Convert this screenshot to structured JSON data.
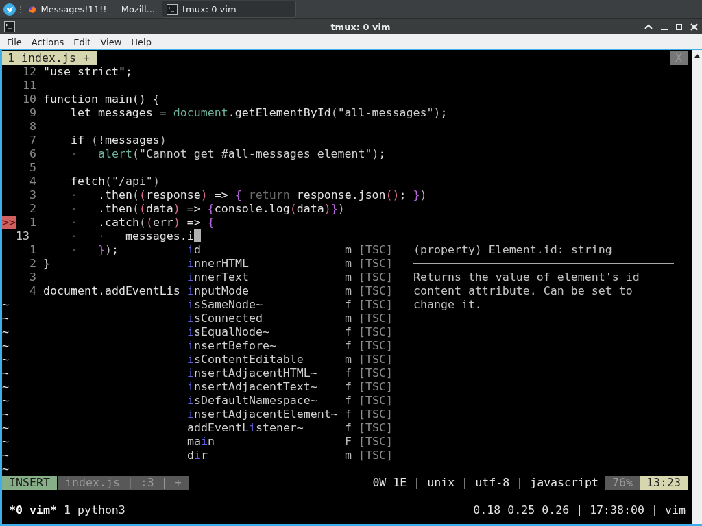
{
  "taskbar": {
    "tasks": [
      {
        "kind": "browser",
        "label": "Messages!11!! — Mozill...",
        "selected": false
      },
      {
        "kind": "terminal",
        "label": "tmux: 0 vim",
        "selected": true
      }
    ]
  },
  "window": {
    "title": "tmux: 0 vim"
  },
  "menu": [
    "File",
    "Actions",
    "Edit",
    "View",
    "Help"
  ],
  "editor": {
    "tabline": {
      "buffer": "1 index.js +",
      "close": "X"
    },
    "rows": [
      {
        "kind": "code",
        "num": "12",
        "current": false,
        "segments": [
          {
            "kind": "text",
            "text": "\"use strict\";"
          }
        ]
      },
      {
        "kind": "code",
        "num": "11",
        "current": false
      },
      {
        "kind": "code",
        "num": "10",
        "current": false,
        "segments": [
          {
            "kind": "text",
            "text": "function main() {"
          }
        ]
      },
      {
        "kind": "code",
        "num": "9",
        "current": false,
        "segments": [
          {
            "kind": "text",
            "text": "    let messages = "
          },
          {
            "kind": "builtin",
            "text": "document"
          },
          {
            "kind": "text",
            "text": ".getElementById"
          },
          {
            "kind": "paren1",
            "text": "("
          },
          {
            "kind": "string",
            "text": "\"all-messages\""
          },
          {
            "kind": "paren1",
            "text": ")"
          },
          {
            "kind": "text",
            "text": ";"
          }
        ]
      },
      {
        "kind": "code",
        "num": "8",
        "current": false
      },
      {
        "kind": "code",
        "num": "7",
        "current": false,
        "segments": [
          {
            "kind": "text",
            "text": "    if "
          },
          {
            "kind": "paren1",
            "text": "("
          },
          {
            "kind": "text",
            "text": "!messages"
          },
          {
            "kind": "paren1",
            "text": ")"
          }
        ]
      },
      {
        "kind": "code",
        "num": "6",
        "current": false,
        "segments": [
          {
            "kind": "guide",
            "text": "    ·   "
          },
          {
            "kind": "builtin",
            "text": "alert"
          },
          {
            "kind": "paren1",
            "text": "("
          },
          {
            "kind": "string",
            "text": "\"Cannot get #all-messages element\""
          },
          {
            "kind": "paren1",
            "text": ")"
          },
          {
            "kind": "text",
            "text": ";"
          }
        ]
      },
      {
        "kind": "code",
        "num": "5",
        "current": false
      },
      {
        "kind": "code",
        "num": "4",
        "current": false,
        "segments": [
          {
            "kind": "text",
            "text": "    fetch"
          },
          {
            "kind": "paren1",
            "text": "("
          },
          {
            "kind": "string",
            "text": "\"/api\""
          },
          {
            "kind": "paren1",
            "text": ")"
          }
        ]
      },
      {
        "kind": "code",
        "num": "3",
        "current": false,
        "segments": [
          {
            "kind": "guide",
            "text": "    ·   "
          },
          {
            "kind": "text",
            "text": ".then"
          },
          {
            "kind": "paren1",
            "text": "("
          },
          {
            "kind": "paren2",
            "text": "("
          },
          {
            "kind": "text",
            "text": "response"
          },
          {
            "kind": "paren2",
            "text": ")"
          },
          {
            "kind": "text",
            "text": " => "
          },
          {
            "kind": "paren3",
            "text": "{"
          },
          {
            "kind": "dim",
            "text": " return"
          },
          {
            "kind": "text",
            "text": " response.json"
          },
          {
            "kind": "paren2",
            "text": "()"
          },
          {
            "kind": "text",
            "text": "; "
          },
          {
            "kind": "paren3",
            "text": "}"
          },
          {
            "kind": "paren1",
            "text": ")"
          }
        ]
      },
      {
        "kind": "code",
        "num": "2",
        "current": false,
        "segments": [
          {
            "kind": "guide",
            "text": "    ·   "
          },
          {
            "kind": "text",
            "text": ".then"
          },
          {
            "kind": "paren1",
            "text": "("
          },
          {
            "kind": "paren2",
            "text": "("
          },
          {
            "kind": "text",
            "text": "data"
          },
          {
            "kind": "paren2",
            "text": ")"
          },
          {
            "kind": "text",
            "text": " => "
          },
          {
            "kind": "paren3",
            "text": "{"
          },
          {
            "kind": "text",
            "text": "console.log"
          },
          {
            "kind": "paren2",
            "text": "("
          },
          {
            "kind": "text",
            "text": "data"
          },
          {
            "kind": "paren2",
            "text": ")"
          },
          {
            "kind": "paren3",
            "text": "}"
          },
          {
            "kind": "paren1",
            "text": ")"
          }
        ]
      },
      {
        "kind": "code",
        "num": "1",
        "current": false,
        "sign": {
          "kind": "error",
          "text": ">>"
        },
        "segments": [
          {
            "kind": "guide",
            "text": "    ·   "
          },
          {
            "kind": "text",
            "text": ".catch"
          },
          {
            "kind": "paren1",
            "text": "("
          },
          {
            "kind": "paren2",
            "text": "("
          },
          {
            "kind": "text",
            "text": "err"
          },
          {
            "kind": "paren2",
            "text": ")"
          },
          {
            "kind": "text",
            "text": " => "
          },
          {
            "kind": "paren3",
            "text": "{"
          }
        ]
      },
      {
        "kind": "code",
        "num": "13",
        "current": true,
        "segments": [
          {
            "kind": "guide",
            "text": "    ·   ·   "
          },
          {
            "kind": "text",
            "text": "messages.i"
          }
        ]
      },
      {
        "kind": "code",
        "num": "1",
        "current": false,
        "segments": [
          {
            "kind": "guide",
            "text": "    ·   "
          },
          {
            "kind": "paren3",
            "text": "}"
          },
          {
            "kind": "paren1",
            "text": ")"
          },
          {
            "kind": "text",
            "text": ";"
          }
        ]
      },
      {
        "kind": "code",
        "num": "2",
        "current": false,
        "segments": [
          {
            "kind": "text",
            "text": "}"
          }
        ]
      },
      {
        "kind": "code",
        "num": "3",
        "current": false
      },
      {
        "kind": "code",
        "num": "4",
        "current": false,
        "segments": [
          {
            "kind": "text",
            "text": "document.addEventLis"
          }
        ]
      },
      {
        "kind": "filler",
        "text": "~"
      },
      {
        "kind": "filler",
        "text": "~"
      },
      {
        "kind": "filler",
        "text": "~"
      },
      {
        "kind": "filler",
        "text": "~"
      },
      {
        "kind": "filler",
        "text": "~"
      },
      {
        "kind": "filler",
        "text": "~"
      },
      {
        "kind": "filler",
        "text": "~"
      },
      {
        "kind": "filler",
        "text": "~"
      },
      {
        "kind": "filler",
        "text": "~"
      },
      {
        "kind": "filler",
        "text": "~"
      },
      {
        "kind": "filler",
        "text": "~"
      },
      {
        "kind": "filler",
        "text": "~"
      },
      {
        "kind": "filler",
        "text": "~"
      }
    ],
    "completion": {
      "items": [
        {
          "parts": [
            {
              "text": "i",
              "match": true
            },
            {
              "text": "d",
              "match": false
            }
          ],
          "type": "m",
          "source": "[TSC]"
        },
        {
          "parts": [
            {
              "text": "i",
              "match": true
            },
            {
              "text": "nnerHTML",
              "match": false
            }
          ],
          "type": "m",
          "source": "[TSC]"
        },
        {
          "parts": [
            {
              "text": "i",
              "match": true
            },
            {
              "text": "nnerText",
              "match": false
            }
          ],
          "type": "m",
          "source": "[TSC]"
        },
        {
          "parts": [
            {
              "text": "i",
              "match": true
            },
            {
              "text": "nputMode",
              "match": false
            }
          ],
          "type": "m",
          "source": "[TSC]"
        },
        {
          "parts": [
            {
              "text": "i",
              "match": true
            },
            {
              "text": "sSameNode~",
              "match": false
            }
          ],
          "type": "f",
          "source": "[TSC]"
        },
        {
          "parts": [
            {
              "text": "i",
              "match": true
            },
            {
              "text": "sConnected",
              "match": false
            }
          ],
          "type": "m",
          "source": "[TSC]"
        },
        {
          "parts": [
            {
              "text": "i",
              "match": true
            },
            {
              "text": "sEqualNode~",
              "match": false
            }
          ],
          "type": "f",
          "source": "[TSC]"
        },
        {
          "parts": [
            {
              "text": "i",
              "match": true
            },
            {
              "text": "nsertBefore~",
              "match": false
            }
          ],
          "type": "f",
          "source": "[TSC]"
        },
        {
          "parts": [
            {
              "text": "i",
              "match": true
            },
            {
              "text": "sContentEditable",
              "match": false
            }
          ],
          "type": "m",
          "source": "[TSC]"
        },
        {
          "parts": [
            {
              "text": "i",
              "match": true
            },
            {
              "text": "nsertAdjacentHTML~",
              "match": false
            }
          ],
          "type": "f",
          "source": "[TSC]"
        },
        {
          "parts": [
            {
              "text": "i",
              "match": true
            },
            {
              "text": "nsertAdjacentText~",
              "match": false
            }
          ],
          "type": "f",
          "source": "[TSC]"
        },
        {
          "parts": [
            {
              "text": "i",
              "match": true
            },
            {
              "text": "sDefaultNamespace~",
              "match": false
            }
          ],
          "type": "f",
          "source": "[TSC]"
        },
        {
          "parts": [
            {
              "text": "i",
              "match": true
            },
            {
              "text": "nsertAdjacentElement~",
              "match": false
            }
          ],
          "type": "f",
          "source": "[TSC]"
        },
        {
          "parts": [
            {
              "text": "addEventL",
              "match": false
            },
            {
              "text": "i",
              "match": true
            },
            {
              "text": "stener~",
              "match": false
            }
          ],
          "type": "f",
          "source": "[TSC]"
        },
        {
          "parts": [
            {
              "text": "ma",
              "match": false
            },
            {
              "text": "i",
              "match": true
            },
            {
              "text": "n",
              "match": false
            }
          ],
          "type": "F",
          "source": "[TSC]"
        },
        {
          "parts": [
            {
              "text": "d",
              "match": false
            },
            {
              "text": "i",
              "match": true
            },
            {
              "text": "r",
              "match": false
            }
          ],
          "type": "m",
          "source": "[TSC]"
        }
      ],
      "preview": {
        "signature": "(property) Element.id: string",
        "doc": "Returns the value of element's id content attribute. Can be set to change it."
      }
    },
    "status": {
      "left": [
        {
          "kind": "mode",
          "text": "INSERT"
        },
        {
          "kind": "file",
          "text": "index.js | :3 | +"
        }
      ],
      "right": [
        {
          "kind": "info",
          "text": "0W 1E | unix | utf-8 | javascript"
        },
        {
          "kind": "percent",
          "text": "76%"
        },
        {
          "kind": "position",
          "text": "13:23"
        }
      ]
    }
  },
  "tmux": {
    "windows": [
      {
        "label": "*0 vim*",
        "selected": true
      },
      {
        "label": "1 python3",
        "selected": false
      }
    ],
    "right": "0.18 0.25 0.26 | 17:38:00 | vim"
  }
}
